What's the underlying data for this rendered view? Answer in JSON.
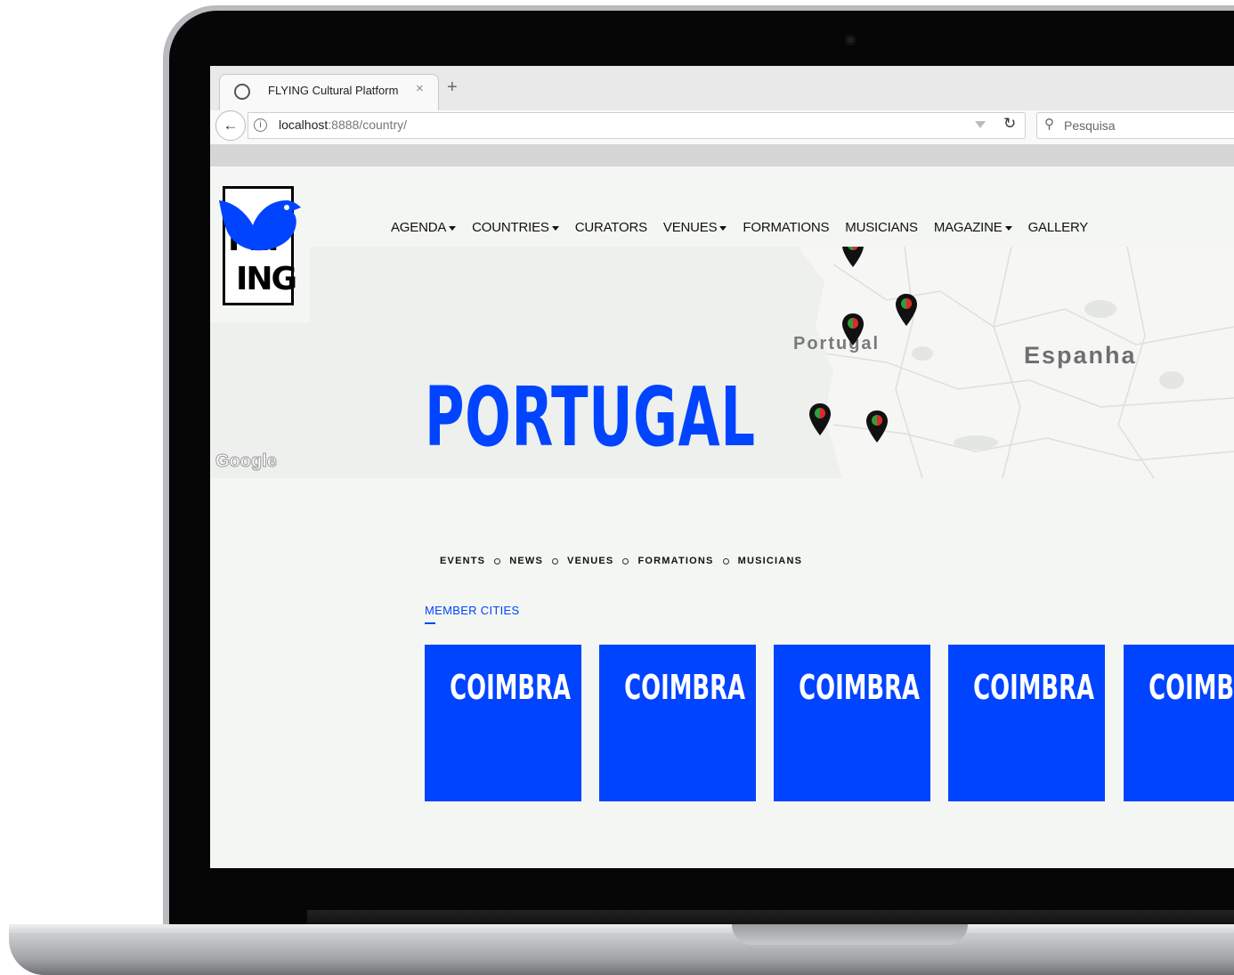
{
  "browser": {
    "tab_title": "FLYING Cultural Platform",
    "tab_close": "×",
    "new_tab": "+",
    "url_host": "localhost",
    "url_rest": ":8888/country/",
    "search_placeholder": "Pesquisa"
  },
  "site": {
    "logo_line1": "FLY",
    "logo_line2": "ING",
    "nav": [
      {
        "label": "AGENDA",
        "dropdown": true
      },
      {
        "label": "COUNTRIES",
        "dropdown": true
      },
      {
        "label": "CURATORS",
        "dropdown": false
      },
      {
        "label": "VENUES",
        "dropdown": true
      },
      {
        "label": "FORMATIONS",
        "dropdown": false
      },
      {
        "label": "MUSICIANS",
        "dropdown": false
      },
      {
        "label": "MAGAZINE",
        "dropdown": true
      },
      {
        "label": "GALLERY",
        "dropdown": false
      }
    ],
    "map": {
      "label_portugal": "Portugal",
      "label_spain": "Espanha",
      "google": "Google"
    },
    "page_title": "PORTUGAL",
    "sub_nav": [
      "EVENTS",
      "NEWS",
      "VENUES",
      "FORMATIONS",
      "MUSICIANS"
    ],
    "section_title": "MEMBER CITIES",
    "cities": [
      "COIMBRA",
      "COIMBRA",
      "COIMBRA",
      "COIMBRA",
      "COIMBRA"
    ]
  },
  "colors": {
    "brand_blue": "#0044ff",
    "page_bg": "#f4f6f3"
  },
  "icons": [
    "favicon-icon",
    "back-arrow-icon",
    "info-icon",
    "dropdown-icon",
    "reload-icon",
    "search-icon",
    "map-marker-icon",
    "bird-logo-icon"
  ]
}
